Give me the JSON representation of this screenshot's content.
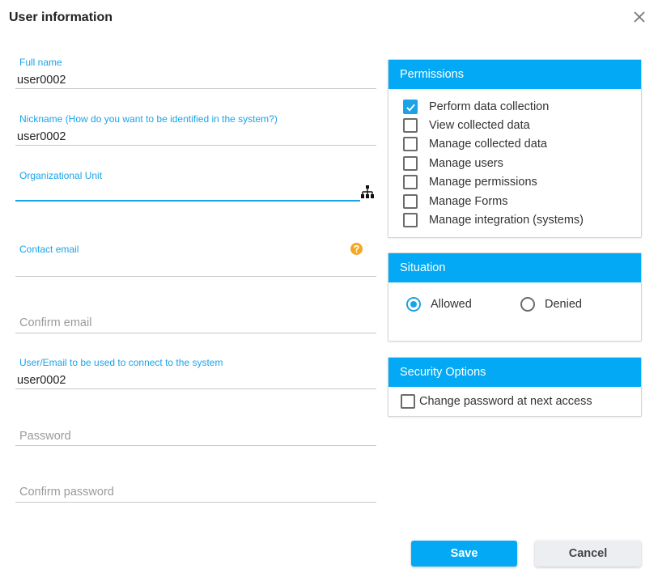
{
  "dialog": {
    "title": "User information",
    "close_icon": "close-icon"
  },
  "form": {
    "full_name": {
      "label": "Full name",
      "value": "user0002"
    },
    "nickname": {
      "label": "Nickname (How do you want to be identified in the system?)",
      "value": "user0002"
    },
    "org_unit": {
      "label": "Organizational Unit",
      "value": "",
      "icon": "org-chart-icon"
    },
    "contact_email": {
      "label": "Contact email",
      "value": "",
      "icon": "help-icon"
    },
    "confirm_email": {
      "placeholder": "Confirm email",
      "value": ""
    },
    "login": {
      "label": "User/Email to be used to connect to the system",
      "value": "user0002"
    },
    "password": {
      "placeholder": "Password",
      "value": ""
    },
    "confirm_password": {
      "placeholder": "Confirm password",
      "value": ""
    }
  },
  "permissions": {
    "title": "Permissions",
    "items": [
      {
        "label": "Perform data collection",
        "checked": true
      },
      {
        "label": "View collected data",
        "checked": false
      },
      {
        "label": "Manage collected data",
        "checked": false
      },
      {
        "label": "Manage users",
        "checked": false
      },
      {
        "label": "Manage permissions",
        "checked": false
      },
      {
        "label": "Manage Forms",
        "checked": false
      },
      {
        "label": "Manage integration (systems)",
        "checked": false
      }
    ]
  },
  "situation": {
    "title": "Situation",
    "options": [
      {
        "label": "Allowed",
        "selected": true
      },
      {
        "label": "Denied",
        "selected": false
      }
    ]
  },
  "security": {
    "title": "Security Options",
    "change_password": {
      "label": "Change password at next access",
      "checked": false
    }
  },
  "actions": {
    "save_label": "Save",
    "cancel_label": "Cancel"
  },
  "colors": {
    "accent": "#03a9f4",
    "label": "#1aa3e8",
    "help": "#f5a623"
  }
}
